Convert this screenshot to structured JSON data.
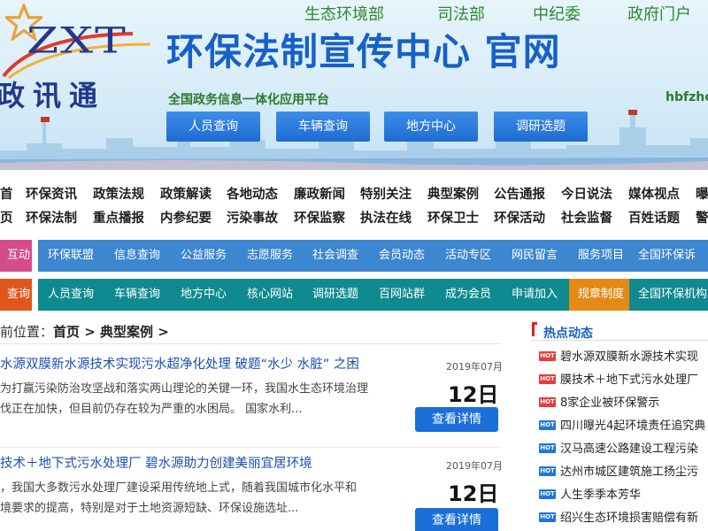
{
  "header": {
    "logo_latin": "ZXT",
    "logo_cn": "政讯通",
    "title": "环保法制宣传中心 官网",
    "platform": "全国政务信息一体化应用平台",
    "domain": "hbfzho",
    "top_links": [
      "生态环境部",
      "司法部",
      "中纪委",
      "政府门户"
    ],
    "buttons": [
      "人员查询",
      "车辆查询",
      "地方中心",
      "调研选题"
    ]
  },
  "nav": {
    "lead": [
      "首",
      "页"
    ],
    "row1": [
      "环保资讯",
      "政策法规",
      "政策解读",
      "各地动态",
      "廉政新闻",
      "特别关注",
      "典型案例",
      "公告通报",
      "今日说法",
      "媒体视点",
      "曝"
    ],
    "row2": [
      "环保法制",
      "重点播报",
      "内参纪要",
      "污染事故",
      "环保监察",
      "执法在线",
      "环保卫士",
      "环保活动",
      "社会监督",
      "百姓话题",
      "警"
    ]
  },
  "bar1": {
    "tag": "互动",
    "items": [
      "环保联盟",
      "信息查询",
      "公益服务",
      "志愿服务",
      "社会调查",
      "会员动态",
      "活动专区",
      "网民留言",
      "服务项目",
      "全国环保诉"
    ]
  },
  "bar2": {
    "tag": "查询",
    "items": [
      "人员查询",
      "车辆查询",
      "地方中心",
      "核心网站",
      "调研选题",
      "百网站群",
      "成为会员",
      "申请加入",
      "规章制度",
      "全国环保机构"
    ],
    "highlight_color": "#e58a16"
  },
  "breadcrumb": {
    "prefix": "前位置：",
    "home": "首页",
    "sep1": " > ",
    "current": "典型案例",
    "sep2": " >"
  },
  "articles": [
    {
      "title": "水源双膜新水源技术实现污水超净化处理 破题“水少 水脏” 之困",
      "date": "2019年07月",
      "day": "12日",
      "summary": [
        "为打赢污染防治攻坚战和落实两山理论的关键一环，我国水生态环境治理",
        "伐正在加快，但目前仍存在较为严重的水困局。 国家水利..."
      ],
      "button": "查看详情"
    },
    {
      "title": "技术＋地下式污水处理厂 碧水源助力创建美丽宜居环境",
      "date": "2019年07月",
      "day": "12日",
      "summary": [
        "，我国大多数污水处理厂建设采用传统地上式，随着我国城市化水平和",
        "境要求的提高，特别是对于土地资源短缺、环保设施选址..."
      ],
      "button": "查看详情"
    }
  ],
  "hot": {
    "title": "热点动态",
    "items": [
      {
        "badge": "HOT",
        "text": "碧水源双膜新水源技术实现"
      },
      {
        "badge": "HOT",
        "text": "膜技术＋地下式污水处理厂"
      },
      {
        "badge": "HOT",
        "text": "8家企业被环保警示"
      },
      {
        "badge": "HOT",
        "text": "四川曝光4起环境责任追究典"
      },
      {
        "badge": "HOT",
        "text": "汉马高速公路建设工程污染"
      },
      {
        "badge": "HOT",
        "text": "达州市城区建筑施工扬尘污"
      },
      {
        "badge": "HOT",
        "text": "人生季季本芳华"
      },
      {
        "badge": "HOT",
        "text": "绍兴生态环境损害赔偿有新"
      }
    ]
  },
  "colors": {
    "title_blue": "#1760c7",
    "green": "#2a8a2e",
    "bar1_tag": "#d44d8a",
    "bar1_track": "#3d86d0",
    "bar2_tag": "#e0571c",
    "bar2_track": "#0f8a8e"
  }
}
